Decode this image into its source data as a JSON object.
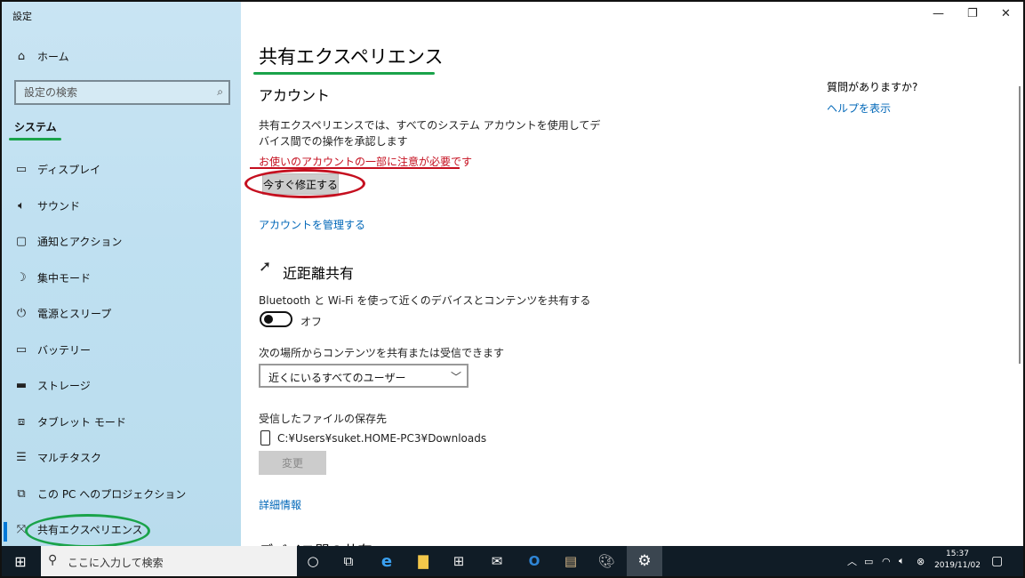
{
  "window": {
    "app_title": "設定"
  },
  "sidebar": {
    "home_label": "ホーム",
    "search_placeholder": "設定の検索",
    "section_header": "システム",
    "items": [
      {
        "label": "ディスプレイ",
        "icon": "display-icon"
      },
      {
        "label": "サウンド",
        "icon": "speaker-icon"
      },
      {
        "label": "通知とアクション",
        "icon": "notification-icon"
      },
      {
        "label": "集中モード",
        "icon": "moon-icon"
      },
      {
        "label": "電源とスリープ",
        "icon": "power-icon"
      },
      {
        "label": "バッテリー",
        "icon": "battery-icon"
      },
      {
        "label": "ストレージ",
        "icon": "storage-icon"
      },
      {
        "label": "タブレット モード",
        "icon": "tablet-icon"
      },
      {
        "label": "マルチタスク",
        "icon": "multitask-icon"
      },
      {
        "label": "この PC へのプロジェクション",
        "icon": "projection-icon"
      },
      {
        "label": "共有エクスペリエンス",
        "icon": "shared-experience-icon"
      }
    ]
  },
  "main": {
    "page_title": "共有エクスペリエンス",
    "account": {
      "title": "アカウント",
      "description": "共有エクスペリエンスでは、すべてのシステム アカウントを使用してデバイス間での操作を承認します",
      "warning": "お使いのアカウントの一部に注意が必要です",
      "fix_button": "今すぐ修正する",
      "manage_link": "アカウントを管理する"
    },
    "nearby": {
      "title": "近距離共有",
      "description": "Bluetooth と Wi-Fi を使って近くのデバイスとコンテンツを共有する",
      "toggle_state": "オフ",
      "receive_label": "次の場所からコンテンツを共有または受信できます",
      "receive_option": "近くにいるすべてのユーザー",
      "save_location_label": "受信したファイルの保存先",
      "save_path": "C:¥Users¥suket.HOME-PC3¥Downloads",
      "change_button": "変更",
      "details_link": "詳細情報"
    },
    "next_section_partial": "デバイス間の共有",
    "help": {
      "question": "質問がありますか?",
      "link": "ヘルプを表示"
    }
  },
  "taskbar": {
    "search_placeholder": "ここに入力して検索",
    "time": "15:37",
    "date": "2019/11/02"
  },
  "colors": {
    "accent": "#0078d7",
    "link": "#0067b8",
    "warning": "#c50f1f",
    "annotation_green": "#1aa34a",
    "taskbar": "#101c26"
  }
}
